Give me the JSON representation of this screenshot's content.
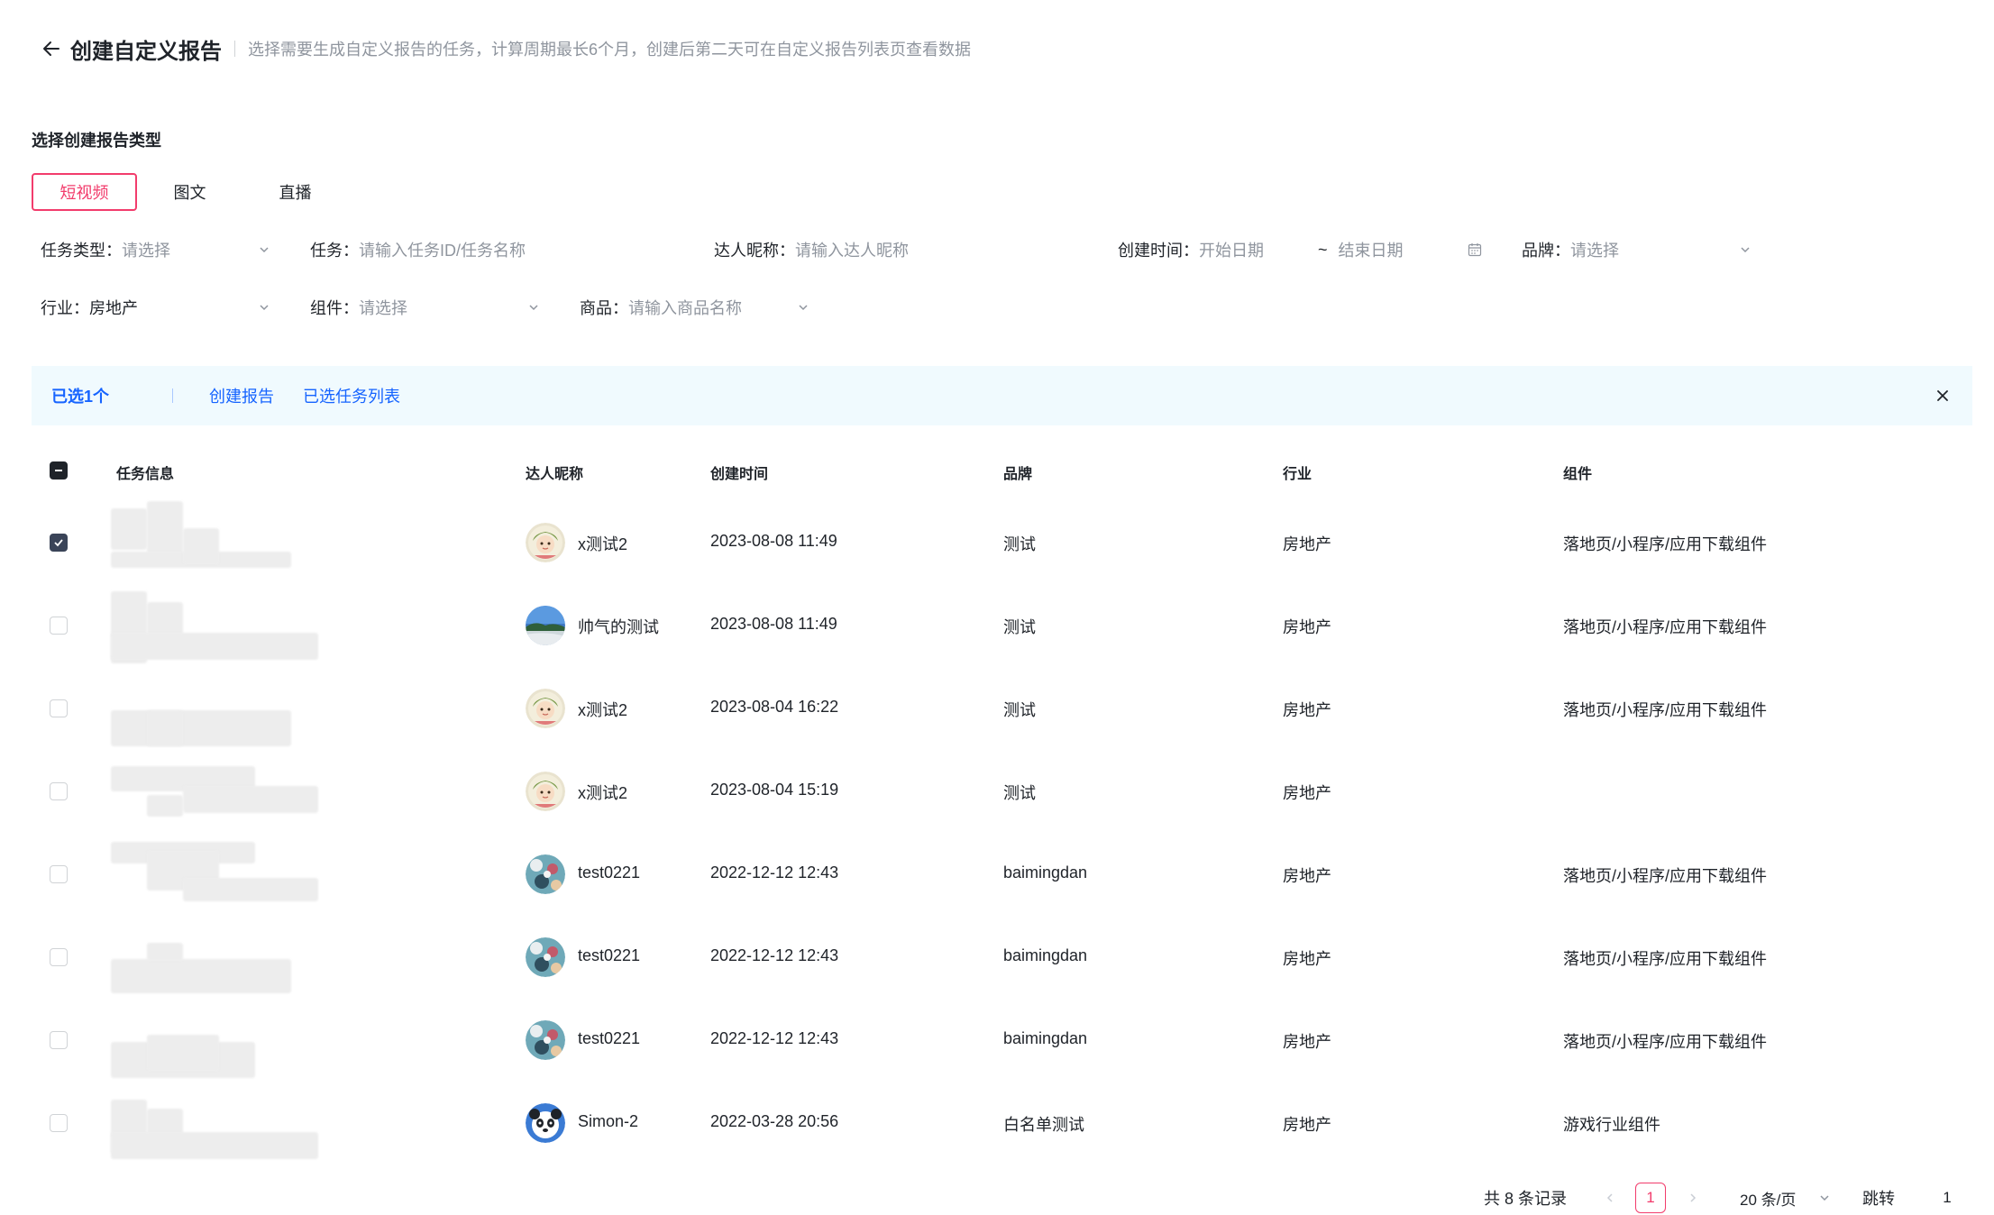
{
  "header": {
    "title": "创建自定义报告",
    "description": "选择需要生成自定义报告的任务，计算周期最长6个月，创建后第二天可在自定义报告列表页查看数据"
  },
  "section_label": "选择创建报告类型",
  "tabs": [
    {
      "label": "短视频",
      "active": true
    },
    {
      "label": "图文",
      "active": false
    },
    {
      "label": "直播",
      "active": false
    }
  ],
  "filters": {
    "task_type": {
      "label": "任务类型：",
      "placeholder": "请选择"
    },
    "task": {
      "label": "任务：",
      "placeholder": "请输入任务ID/任务名称"
    },
    "creator": {
      "label": "达人昵称：",
      "placeholder": "请输入达人昵称"
    },
    "created_time": {
      "label": "创建时间：",
      "start_placeholder": "开始日期",
      "separator": "~",
      "end_placeholder": "结束日期"
    },
    "brand": {
      "label": "品牌：",
      "placeholder": "请选择"
    },
    "industry": {
      "label": "行业：",
      "value": "房地产"
    },
    "component": {
      "label": "组件：",
      "placeholder": "请选择"
    },
    "product": {
      "label": "商品：",
      "placeholder": "请输入商品名称"
    }
  },
  "selection_bar": {
    "count_text": "已选1个",
    "create_report": "创建报告",
    "selected_list": "已选任务列表"
  },
  "table": {
    "columns": [
      "任务信息",
      "达人昵称",
      "创建时间",
      "品牌",
      "行业",
      "组件"
    ],
    "rows": [
      {
        "checked": true,
        "creator": "x测试2",
        "avatar": "cartoon-girl",
        "time": "2023-08-08 11:49",
        "brand": "测试",
        "industry": "房地产",
        "component": "落地页/小程序/应用下载组件"
      },
      {
        "checked": false,
        "creator": "帅气的测试",
        "avatar": "landscape",
        "time": "2023-08-08 11:49",
        "brand": "测试",
        "industry": "房地产",
        "component": "落地页/小程序/应用下载组件"
      },
      {
        "checked": false,
        "creator": "x测试2",
        "avatar": "cartoon-girl",
        "time": "2023-08-04 16:22",
        "brand": "测试",
        "industry": "房地产",
        "component": "落地页/小程序/应用下载组件"
      },
      {
        "checked": false,
        "creator": "x测试2",
        "avatar": "cartoon-girl",
        "time": "2023-08-04 15:19",
        "brand": "测试",
        "industry": "房地产",
        "component": ""
      },
      {
        "checked": false,
        "creator": "test0221",
        "avatar": "flowers",
        "time": "2022-12-12 12:43",
        "brand": "baimingdan",
        "industry": "房地产",
        "component": "落地页/小程序/应用下载组件"
      },
      {
        "checked": false,
        "creator": "test0221",
        "avatar": "flowers",
        "time": "2022-12-12 12:43",
        "brand": "baimingdan",
        "industry": "房地产",
        "component": "落地页/小程序/应用下载组件"
      },
      {
        "checked": false,
        "creator": "test0221",
        "avatar": "flowers",
        "time": "2022-12-12 12:43",
        "brand": "baimingdan",
        "industry": "房地产",
        "component": "落地页/小程序/应用下载组件"
      },
      {
        "checked": false,
        "creator": "Simon-2",
        "avatar": "panda",
        "time": "2022-03-28 20:56",
        "brand": "白名单测试",
        "industry": "房地产",
        "component": "游戏行业组件"
      }
    ]
  },
  "pagination": {
    "total_text": "共 8 条记录",
    "current_page": "1",
    "page_size": "20 条/页",
    "jump_label": "跳转",
    "jump_value": "1"
  },
  "colors": {
    "accent": "#f23c6c",
    "link": "#1664ff",
    "selection_bg": "#f0fafe",
    "placeholder": "#8f959e"
  }
}
